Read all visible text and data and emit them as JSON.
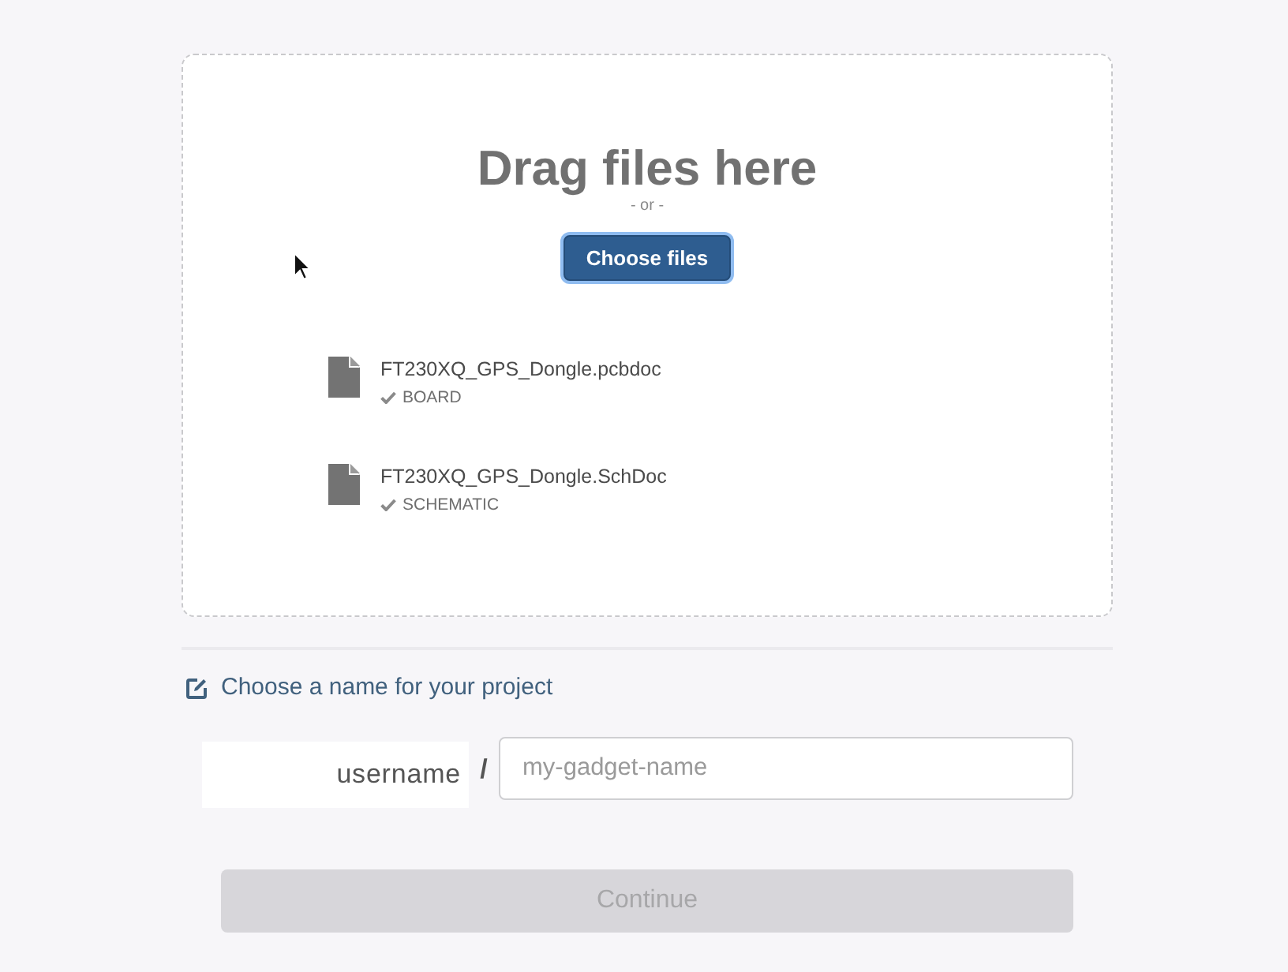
{
  "dropzone": {
    "title": "Drag files here",
    "separator": "- or -",
    "button": {
      "label": "Choose files",
      "focused": true
    },
    "files": [
      {
        "name": "FT230XQ_GPS_Dongle.pcbdoc",
        "type": "BOARD",
        "checked": true
      },
      {
        "name": "FT230XQ_GPS_Dongle.SchDoc",
        "type": "SCHEMATIC",
        "checked": true
      }
    ]
  },
  "project": {
    "heading": "Choose a name for your project",
    "owner": "username",
    "separator": "/",
    "name_field": {
      "placeholder": "my-gadget-name"
    }
  },
  "continue_button": {
    "label": "Continue",
    "disabled": true
  }
}
